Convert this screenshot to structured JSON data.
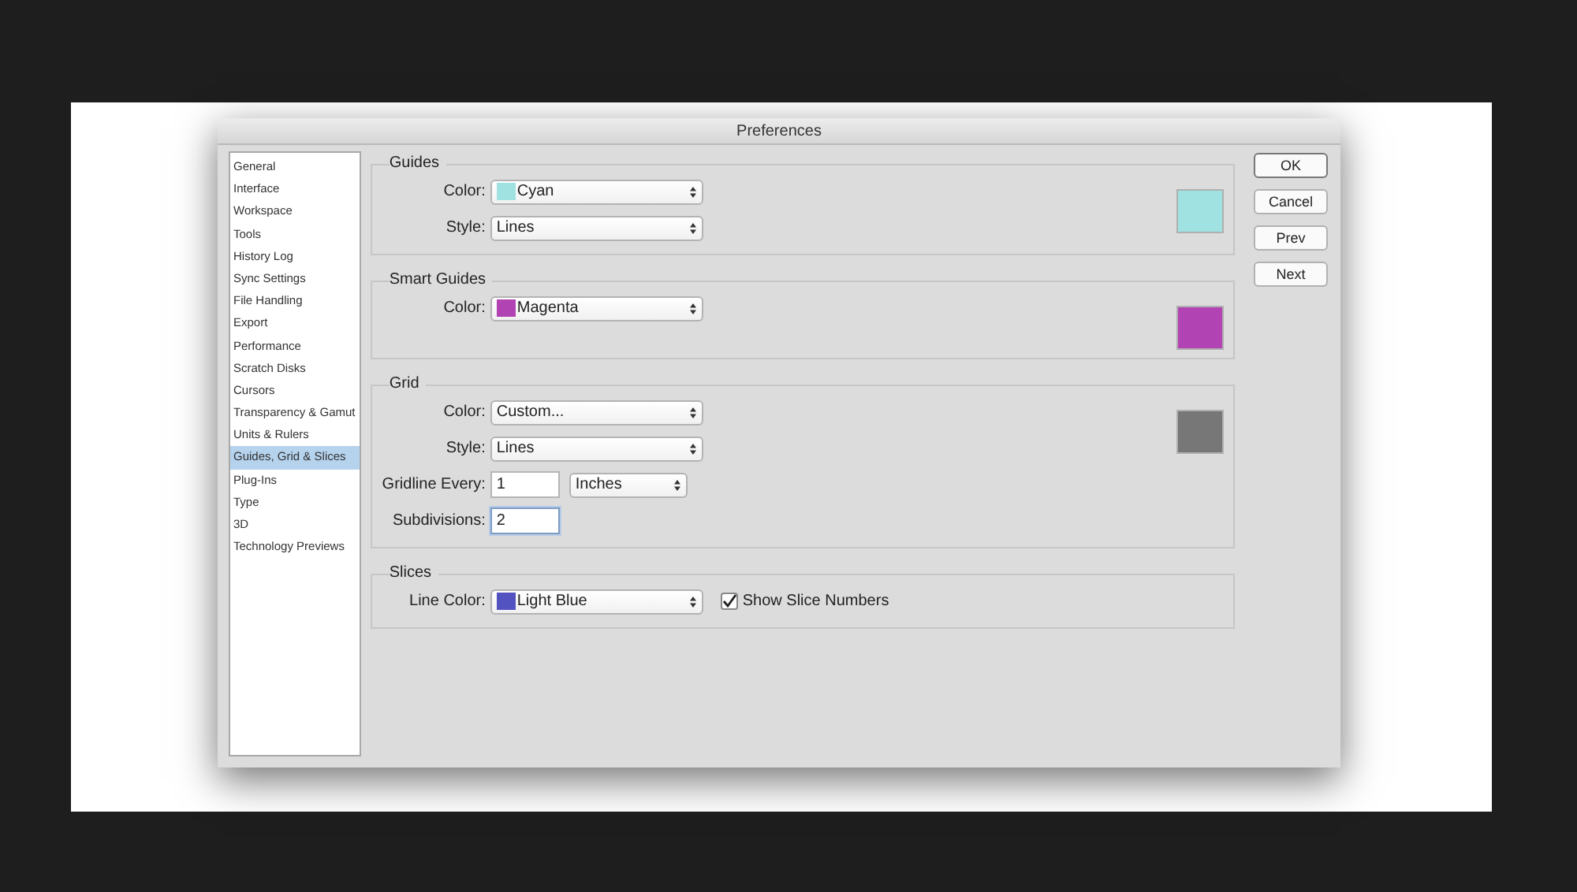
{
  "window": {
    "title": "Preferences"
  },
  "sidebar": {
    "items": [
      {
        "label": "General",
        "selected": false
      },
      {
        "label": "Interface",
        "selected": false
      },
      {
        "label": "Workspace",
        "selected": false
      },
      {
        "label": "Tools",
        "selected": false
      },
      {
        "label": "History Log",
        "selected": false
      },
      {
        "label": "Sync Settings",
        "selected": false
      },
      {
        "label": "File Handling",
        "selected": false
      },
      {
        "label": "Export",
        "selected": false
      },
      {
        "label": "Performance",
        "selected": false
      },
      {
        "label": "Scratch Disks",
        "selected": false
      },
      {
        "label": "Cursors",
        "selected": false
      },
      {
        "label": "Transparency & Gamut",
        "selected": false
      },
      {
        "label": "Units & Rulers",
        "selected": false
      },
      {
        "label": "Guides, Grid & Slices",
        "selected": true
      },
      {
        "label": "Plug-Ins",
        "selected": false
      },
      {
        "label": "Type",
        "selected": false
      },
      {
        "label": "3D",
        "selected": false
      },
      {
        "label": "Technology Previews",
        "selected": false
      }
    ]
  },
  "sections": [
    {
      "title": "Guides",
      "color": "#a0e2e2",
      "rows": [
        {
          "kind": "select",
          "label": "Color:",
          "value": "Cyan",
          "color": "#a0e2e2"
        },
        {
          "kind": "select",
          "label": "Style:",
          "value": "Lines"
        }
      ]
    },
    {
      "title": "Smart Guides",
      "color": "#b243b2",
      "rows": [
        {
          "kind": "select",
          "label": "Color:",
          "value": "Magenta",
          "color": "#b243b2"
        }
      ]
    },
    {
      "title": "Grid",
      "color": "#777777",
      "rows": [
        {
          "kind": "select",
          "label": "Color:",
          "value": "Custom..."
        },
        {
          "kind": "select",
          "label": "Style:",
          "value": "Lines"
        },
        {
          "kind": "number_unit",
          "label": "Gridline Every:",
          "value": "1",
          "unit": "Inches",
          "focused": false
        },
        {
          "kind": "number",
          "label": "Subdivisions:",
          "value": "2",
          "focused": true
        }
      ]
    },
    {
      "title": "Slices",
      "rows": [
        {
          "kind": "select",
          "label": "Line Color:",
          "value": "Light Blue",
          "color": "#5252c0",
          "checkbox": {
            "label": "Show Slice Numbers",
            "checked": true
          }
        }
      ]
    }
  ],
  "buttons": [
    {
      "label": "OK",
      "default": true
    },
    {
      "label": "Cancel",
      "default": false
    },
    {
      "label": "Prev",
      "default": false
    },
    {
      "label": "Next",
      "default": false
    }
  ]
}
